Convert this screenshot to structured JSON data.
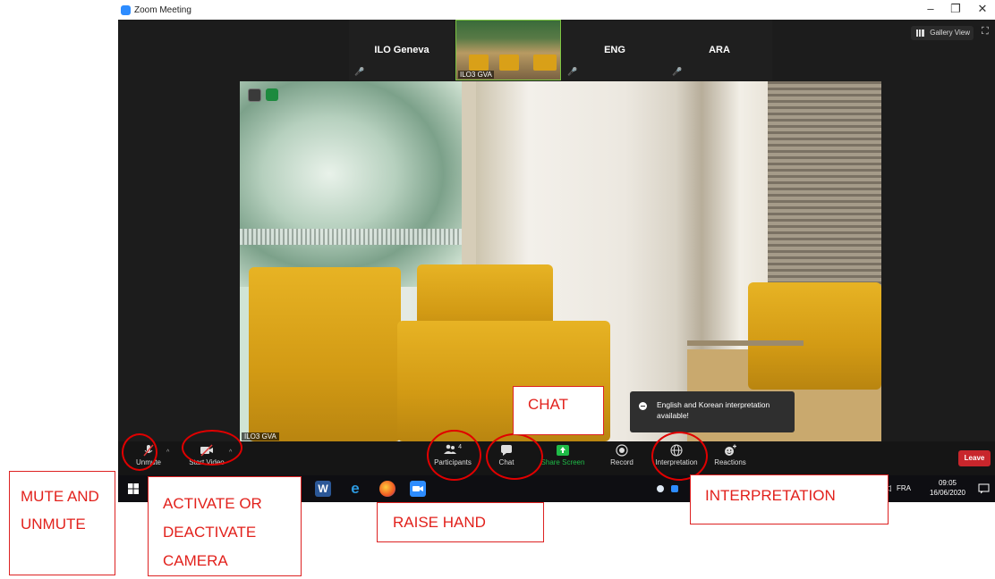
{
  "window": {
    "title": "Zoom Meeting",
    "controls": [
      "–",
      "❐",
      "✕"
    ]
  },
  "top_bar": {
    "gallery_view_label": "Gallery View",
    "fullscreen_icon": "fullscreen-icon"
  },
  "participants_strip": [
    {
      "name": "ILO Geneva",
      "muted": true
    },
    {
      "name": "ILO3 GVA",
      "muted": false,
      "video": true
    },
    {
      "name": "ENG",
      "muted": true
    },
    {
      "name": "ARA",
      "muted": true
    }
  ],
  "main_video": {
    "participant_label": "ILO3 GVA"
  },
  "toast": {
    "text": "English and Korean interpretation available!"
  },
  "toolbar": {
    "unmute_label": "Unmute",
    "start_video_label": "Start Video",
    "participants_label": "Participants",
    "participants_count": "4",
    "chat_label": "Chat",
    "share_screen_label": "Share Screen",
    "record_label": "Record",
    "interpretation_label": "Interpretation",
    "reactions_label": "Reactions",
    "leave_label": "Leave"
  },
  "taskbar": {
    "language": "FRA",
    "time": "09:05",
    "date": "16/06/2020"
  },
  "callouts": {
    "mute": "MUTE AND UNMUTE",
    "camera": "ACTIVATE OR DEACTIVATE CAMERA",
    "raise_hand": "RAISE HAND",
    "chat": "CHAT",
    "interpretation": "INTERPRETATION"
  },
  "colors": {
    "accent_red": "#e2211c",
    "zoom_blue": "#2d8cff",
    "share_green": "#1fbb47",
    "leave_red": "#c8262c"
  }
}
